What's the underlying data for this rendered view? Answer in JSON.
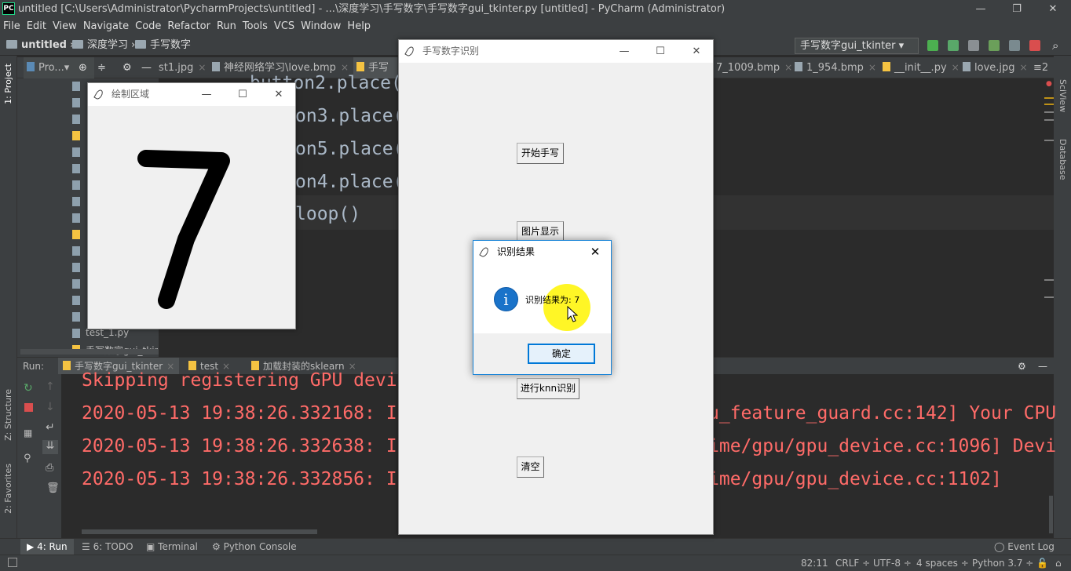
{
  "ide": {
    "window_title": "untitled [C:\\Users\\Administrator\\PycharmProjects\\untitled] - ...\\深度学习\\手写数字\\手写数字gui_tkinter.py [untitled] - PyCharm (Administrator)",
    "logo_text": "PC",
    "menu": [
      "File",
      "Edit",
      "View",
      "Navigate",
      "Code",
      "Refactor",
      "Run",
      "Tools",
      "VCS",
      "Window",
      "Help"
    ],
    "breadcrumb": [
      "untitled",
      "深度学习",
      "手写数字"
    ],
    "run_config": "手写数字gui_tkinter",
    "project_label": "Pro...▾",
    "left_strip": {
      "project": "1: Project",
      "structure": "Z: Structure",
      "favorites": "2: Favorites"
    },
    "right_strip": {
      "sciview": "SciView",
      "database": "Database"
    },
    "tabs": [
      {
        "label": "st1.jpg"
      },
      {
        "label": "神经网络学习\\love.bmp"
      },
      {
        "label": "手写数..."
      },
      {
        "label": "7_1009.bmp"
      },
      {
        "label": "1_954.bmp"
      },
      {
        "label": "__init__.py"
      },
      {
        "label": "love.jpg"
      },
      {
        "label": "≡2"
      }
    ],
    "tree_items": [
      "test_1.py",
      "手写数字gui_tkin"
    ],
    "code_lines": [
      "button2.place(",
      "on3.place(",
      "on5.place(",
      "on4.place(",
      "loop()"
    ],
    "run": {
      "label": "Run:",
      "tabs": [
        "手写数字gui_tkinter",
        "test",
        "加载封装的sklearn"
      ],
      "console_lines": [
        "Skipping registering GPU devi",
        "2020-05-13 19:38:26.332168: I",
        "2020-05-13 19:38:26.332638: I",
        "2020-05-13 19:38:26.332856: I"
      ],
      "console_right": [
        "",
        "u_feature_guard.cc:142] Your CPU",
        "ime/gpu/gpu_device.cc:1096] Devi",
        "ime/gpu/gpu_device.cc:1102]"
      ]
    },
    "bottom_tabs": [
      "4: Run",
      "6: TODO",
      "Terminal",
      "Python Console"
    ],
    "event_log": "Event Log",
    "status": {
      "position": "82:11",
      "line_sep": "CRLF ÷",
      "encoding": "UTF-8 ÷",
      "indent": "4 spaces ÷",
      "interpreter": "Python 3.7 ÷"
    },
    "colors": {
      "bg": "#2b2b2b",
      "panel": "#3c3f41",
      "console_red": "#ff6b68",
      "code": "#a9b7c6"
    }
  },
  "draw_window": {
    "title": "绘制区域",
    "drawn_digit": "7"
  },
  "main_window": {
    "title": "手写数字识别",
    "buttons": {
      "start": "开始手写",
      "show": "图片显示",
      "knn": "进行knn识别",
      "clear": "清空"
    }
  },
  "dialog": {
    "title": "识别结果",
    "message": "识别结果为: 7",
    "ok": "确定",
    "icon": "info-icon"
  }
}
